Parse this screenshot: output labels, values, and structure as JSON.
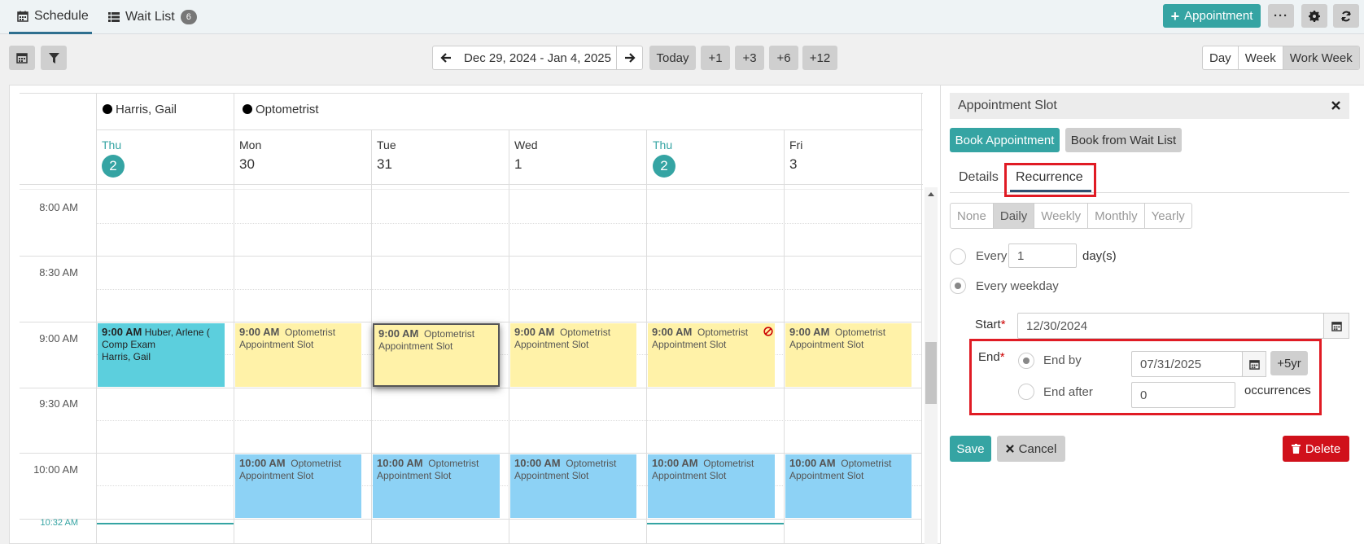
{
  "nav": {
    "schedule_label": "Schedule",
    "waitlist_label": "Wait List",
    "waitlist_count": "6",
    "appointment_button": "Appointment"
  },
  "toolbar": {
    "date_range": "Dec 29, 2024 - Jan 4, 2025",
    "today": "Today",
    "jumps": [
      "+1",
      "+3",
      "+6",
      "+12"
    ],
    "views": [
      "Day",
      "Week",
      "Work Week"
    ],
    "selected_view": "Work Week"
  },
  "calendar": {
    "resources": [
      "Harris, Gail",
      "Optometrist"
    ],
    "days": [
      {
        "name": "Thu",
        "num": "2",
        "today": true
      },
      {
        "name": "Mon",
        "num": "30"
      },
      {
        "name": "Tue",
        "num": "31"
      },
      {
        "name": "Wed",
        "num": "1"
      },
      {
        "name": "Thu",
        "num": "2",
        "today": true
      },
      {
        "name": "Fri",
        "num": "3"
      }
    ],
    "times": [
      "8:00 AM",
      "8:30 AM",
      "9:00 AM",
      "9:30 AM",
      "10:00 AM"
    ],
    "now_time": "10:32 AM",
    "huber": {
      "time": "9:00 AM",
      "name": "Huber, Arlene",
      "suffix": "(",
      "type": "Comp Exam",
      "provider": "Harris, Gail"
    },
    "slot": {
      "time9": "9:00 AM",
      "time10": "10:00 AM",
      "provider": "Optometrist",
      "label": "Appointment Slot"
    }
  },
  "panel": {
    "title": "Appointment Slot",
    "book_appointment": "Book Appointment",
    "book_waitlist": "Book from Wait List",
    "tabs": [
      "Details",
      "Recurrence"
    ],
    "recurrence_types": [
      "None",
      "Daily",
      "Weekly",
      "Monthly",
      "Yearly"
    ],
    "selected_type": "Daily",
    "every_label": "Every",
    "every_value": "1",
    "every_unit": "day(s)",
    "every_weekday_label": "Every weekday",
    "start_label": "Start",
    "start_value": "12/30/2024",
    "end_label": "End",
    "end_by_label": "End by",
    "end_by_value": "07/31/2025",
    "plus5yr": "+5yr",
    "end_after_label": "End after",
    "end_after_value": "0",
    "occurrences_label": "occurrences",
    "save": "Save",
    "cancel": "Cancel",
    "delete": "Delete"
  }
}
